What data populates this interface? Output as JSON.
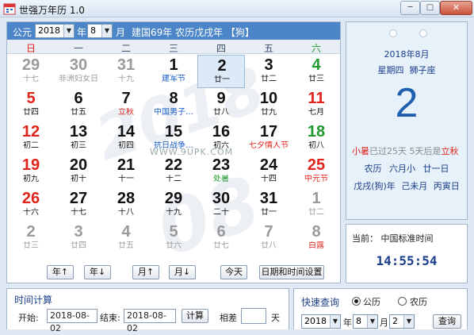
{
  "window": {
    "title": "世强万年历 1.0",
    "minimize": "─",
    "maximize": "□",
    "close": "✕"
  },
  "toolbar": {
    "gongyuan_label": "公元",
    "year_value": "2018",
    "year_label": "年",
    "month_value": "8",
    "month_label": "月",
    "info": "建国69年 农历戊戌年 【狗】"
  },
  "weekdays": [
    "日",
    "一",
    "二",
    "三",
    "四",
    "五",
    "六"
  ],
  "watermark": {
    "url": "WWW.9UPK.COM",
    "year_text": "2018",
    "month_text": "08"
  },
  "days": [
    {
      "n": "29",
      "s": "十七",
      "nc": "gray",
      "sc": "gray"
    },
    {
      "n": "30",
      "s": "非洲妇女日",
      "nc": "gray",
      "sc": "gray"
    },
    {
      "n": "31",
      "s": "十九",
      "nc": "gray",
      "sc": "gray"
    },
    {
      "n": "1",
      "s": "建军节",
      "nc": "black",
      "sc": "blue"
    },
    {
      "n": "2",
      "s": "廿一",
      "nc": "black",
      "sc": "black",
      "selected": true
    },
    {
      "n": "3",
      "s": "廿二",
      "nc": "black",
      "sc": "black"
    },
    {
      "n": "4",
      "s": "廿三",
      "nc": "green",
      "sc": "black"
    },
    {
      "n": "5",
      "s": "廿四",
      "nc": "red",
      "sc": "black"
    },
    {
      "n": "6",
      "s": "廿五",
      "nc": "black",
      "sc": "black"
    },
    {
      "n": "7",
      "s": "立秋",
      "nc": "black",
      "sc": "red"
    },
    {
      "n": "8",
      "s": "中国男子…",
      "nc": "black",
      "sc": "blue"
    },
    {
      "n": "9",
      "s": "廿八",
      "nc": "black",
      "sc": "black"
    },
    {
      "n": "10",
      "s": "廿九",
      "nc": "black",
      "sc": "black"
    },
    {
      "n": "11",
      "s": "七月",
      "nc": "red",
      "sc": "black"
    },
    {
      "n": "12",
      "s": "初二",
      "nc": "red",
      "sc": "black"
    },
    {
      "n": "13",
      "s": "初三",
      "nc": "black",
      "sc": "black"
    },
    {
      "n": "14",
      "s": "初四",
      "nc": "black",
      "sc": "black"
    },
    {
      "n": "15",
      "s": "抗日战争…",
      "nc": "black",
      "sc": "blue"
    },
    {
      "n": "16",
      "s": "初六",
      "nc": "black",
      "sc": "black"
    },
    {
      "n": "17",
      "s": "七夕情人节",
      "nc": "black",
      "sc": "red"
    },
    {
      "n": "18",
      "s": "初八",
      "nc": "green",
      "sc": "black"
    },
    {
      "n": "19",
      "s": "初九",
      "nc": "red",
      "sc": "black"
    },
    {
      "n": "20",
      "s": "初十",
      "nc": "black",
      "sc": "black"
    },
    {
      "n": "21",
      "s": "十一",
      "nc": "black",
      "sc": "black"
    },
    {
      "n": "22",
      "s": "十二",
      "nc": "black",
      "sc": "black"
    },
    {
      "n": "23",
      "s": "处暑",
      "nc": "black",
      "sc": "green"
    },
    {
      "n": "24",
      "s": "十四",
      "nc": "black",
      "sc": "black"
    },
    {
      "n": "25",
      "s": "中元节",
      "nc": "red",
      "sc": "red"
    },
    {
      "n": "26",
      "s": "十六",
      "nc": "red",
      "sc": "black"
    },
    {
      "n": "27",
      "s": "十七",
      "nc": "black",
      "sc": "black"
    },
    {
      "n": "28",
      "s": "十八",
      "nc": "black",
      "sc": "black"
    },
    {
      "n": "29",
      "s": "十九",
      "nc": "black",
      "sc": "black"
    },
    {
      "n": "30",
      "s": "二十",
      "nc": "black",
      "sc": "black"
    },
    {
      "n": "31",
      "s": "廿一",
      "nc": "black",
      "sc": "black"
    },
    {
      "n": "1",
      "s": "廿二",
      "nc": "gray",
      "sc": "gray"
    },
    {
      "n": "2",
      "s": "廿三",
      "nc": "gray",
      "sc": "gray"
    },
    {
      "n": "3",
      "s": "廿四",
      "nc": "gray",
      "sc": "gray"
    },
    {
      "n": "4",
      "s": "廿五",
      "nc": "gray",
      "sc": "gray"
    },
    {
      "n": "5",
      "s": "廿六",
      "nc": "gray",
      "sc": "gray"
    },
    {
      "n": "6",
      "s": "廿七",
      "nc": "gray",
      "sc": "gray"
    },
    {
      "n": "7",
      "s": "廿八",
      "nc": "gray",
      "sc": "gray"
    },
    {
      "n": "8",
      "s": "白露",
      "nc": "gray",
      "sc": "red"
    }
  ],
  "nav": {
    "year_up": "年↑",
    "year_down": "年↓",
    "month_up": "月↑",
    "month_down": "月↓",
    "today": "今天",
    "datetime_settings": "日期和时间设置"
  },
  "info_panel": {
    "date_line": "2018年8月",
    "weekday": "星期四",
    "zodiac": "狮子座",
    "day": "2",
    "term_a_name": "小暑",
    "term_a_text": "已过25天",
    "term_b_text": "5天后是",
    "term_b_name": "立秋",
    "lunar_label": "农历",
    "lunar_month": "六月小",
    "lunar_day": "廿一日",
    "gz_year": "戊戌(狗)年",
    "gz_month": "己未月",
    "gz_day": "丙寅日"
  },
  "time_panel": {
    "label": "当前：",
    "tz": "中国标准时间",
    "clock": "14:55:54"
  },
  "calc": {
    "title": "时间计算",
    "start_label": "开始:",
    "start_value": "2018-08-02",
    "end_label": "结束:",
    "end_value": "2018-08-02",
    "calc_button": "计算",
    "diff_label": "相差",
    "diff_value": "",
    "unit": "天"
  },
  "query": {
    "title": "快速查询",
    "gregorian": "公历",
    "lunar": "农历",
    "selected": "gregorian",
    "year_value": "2018",
    "month_value": "8",
    "day_value": "2",
    "button": "查询"
  },
  "colors": {
    "toolbar": "#4d86c8",
    "gray": "#9a9a9a",
    "red": "#e0231b",
    "green": "#1e9a2e",
    "blue": "#1a5cc6",
    "black": "#111111",
    "label_blue": "#1b3e8a"
  }
}
